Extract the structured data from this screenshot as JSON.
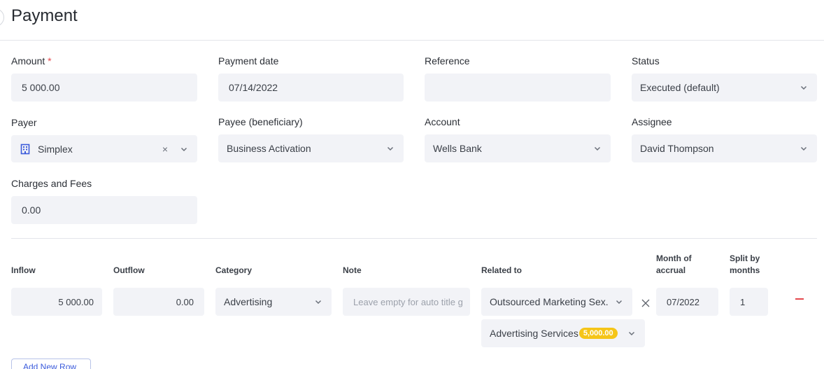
{
  "page": {
    "title": "Payment"
  },
  "form": {
    "amount": {
      "label": "Amount",
      "required_mark": "*",
      "value": "5 000.00"
    },
    "payment_date": {
      "label": "Payment date",
      "value": "07/14/2022"
    },
    "reference": {
      "label": "Reference",
      "value": ""
    },
    "status": {
      "label": "Status",
      "value": "Executed (default)"
    },
    "payer": {
      "label": "Payer",
      "value": "Simplex",
      "icon": "building-icon",
      "clear": "×"
    },
    "payee": {
      "label": "Payee (beneficiary)",
      "value": "Business Activation"
    },
    "account": {
      "label": "Account",
      "value": "Wells Bank"
    },
    "assignee": {
      "label": "Assignee",
      "value": "David Thompson"
    },
    "charges": {
      "label": "Charges and Fees",
      "value": "0.00"
    }
  },
  "split_table": {
    "headers": {
      "inflow": "Inflow",
      "outflow": "Outflow",
      "category": "Category",
      "note": "Note",
      "related_to": "Related to",
      "month_of_accrual": [
        "Month of",
        "accrual"
      ],
      "split_by_months": [
        "Split by",
        "months"
      ]
    },
    "row": {
      "inflow": "5 000.00",
      "outflow": "0.00",
      "category": "Advertising",
      "note_placeholder": "Leave empty for auto title g",
      "related_to": "Outsourced Marketing Sex.",
      "related_sub": {
        "label": "Advertising Services",
        "badge": "5,000.00"
      },
      "month_of_accrual": "07/2022",
      "split_by_months": "1"
    },
    "add_row_label": "Add New Row"
  },
  "colors": {
    "accent": "#3b5bdb",
    "danger": "#e5484d",
    "badge": "#f5c518",
    "field_bg": "#f2f3f7"
  }
}
